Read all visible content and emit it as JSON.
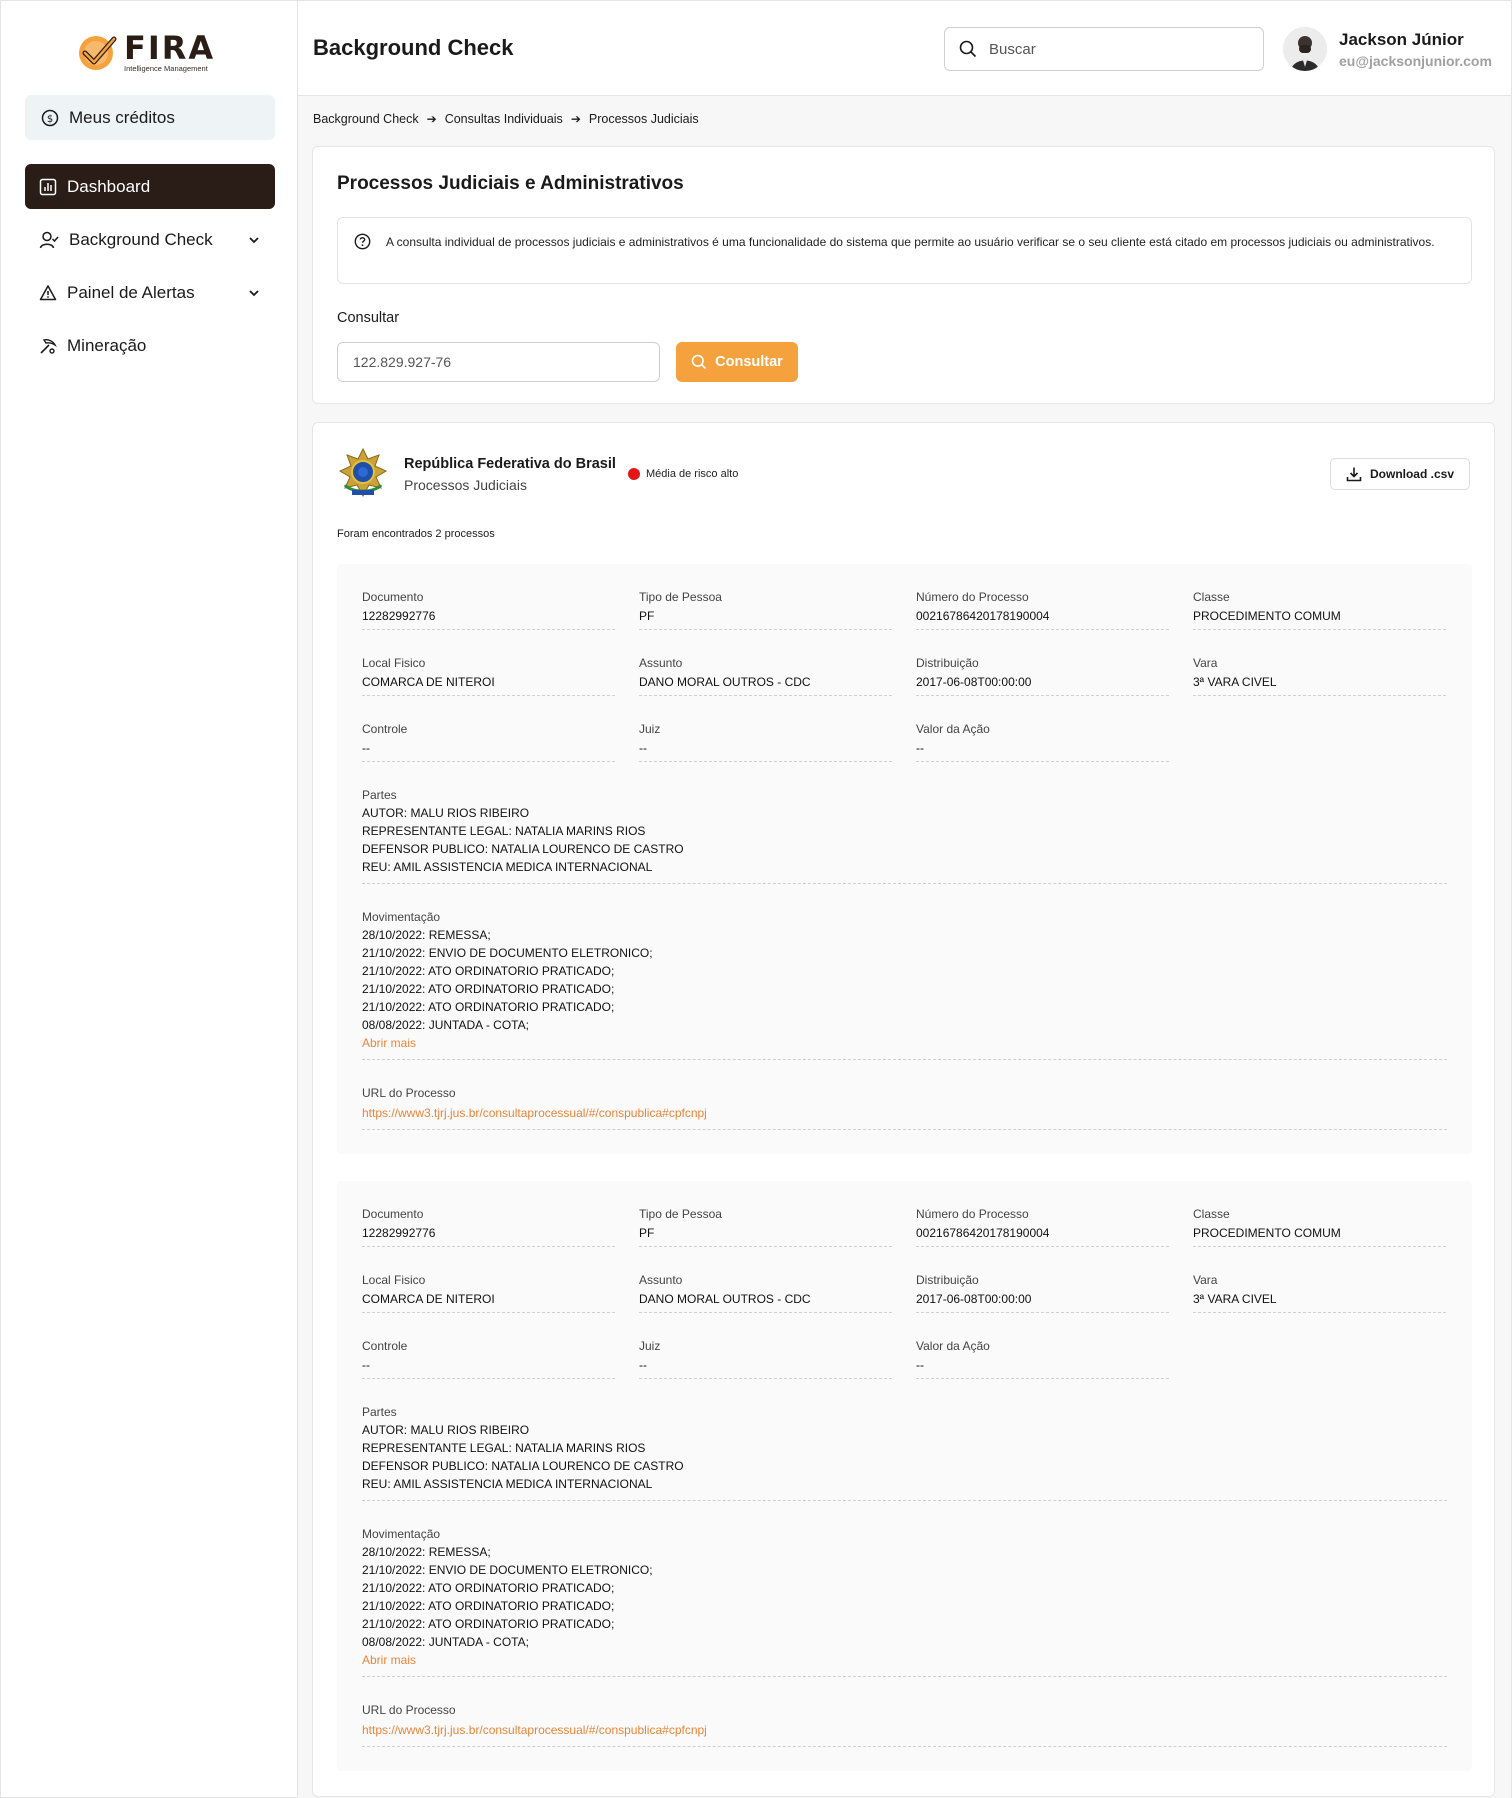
{
  "app": {
    "logo_word": "FIRA",
    "logo_sub": "Intelligence Management",
    "brand_color": "#f5a23e",
    "dark_color": "#2a1c17"
  },
  "sidebar": {
    "credits_label": "Meus créditos",
    "items": [
      {
        "label": "Dashboard",
        "icon": "chart-icon",
        "active": true
      },
      {
        "label": "Background Check",
        "icon": "user-check-icon",
        "chevron": true
      },
      {
        "label": "Painel de Alertas",
        "icon": "warning-icon",
        "chevron": true
      },
      {
        "label": "Mineração",
        "icon": "mining-icon"
      }
    ]
  },
  "header": {
    "title": "Background Check",
    "search_placeholder": "Buscar",
    "user_name": "Jackson Júnior",
    "user_email": "eu@jacksonjunior.com"
  },
  "breadcrumb": [
    "Background Check",
    "Consultas Individuais",
    "Processos Judiciais"
  ],
  "query_card": {
    "title": "Processos Judiciais e Administrativos",
    "info": "A consulta individual de processos judiciais e administrativos é uma funcionalidade do sistema que permite ao usuário verificar se o seu cliente está citado em processos judiciais ou administrativos.",
    "consult_label": "Consultar",
    "input_value": "122.829.927-76",
    "button_label": "Consultar"
  },
  "result_card": {
    "source_name": "República Federativa do Brasil",
    "source_sub": "Processos Judiciais",
    "risk_label": "Média de risco alto",
    "risk_color": "#e21616",
    "download_label": "Download .csv",
    "found_text": "Foram encontrados 2 processos",
    "processes": [
      {
        "documento_label": "Documento",
        "documento": "12282992776",
        "tipo_label": "Tipo de Pessoa",
        "tipo": "PF",
        "numero_label": "Número do Processo",
        "numero": "00216786420178190004",
        "classe_label": "Classe",
        "classe": "PROCEDIMENTO COMUM",
        "local_label": "Local Fisico",
        "local": "COMARCA DE NITEROI",
        "assunto_label": "Assunto",
        "assunto": "DANO MORAL OUTROS - CDC",
        "distribuicao_label": "Distribuição",
        "distribuicao": "2017-06-08T00:00:00",
        "vara_label": "Vara",
        "vara": "3ª VARA CIVEL",
        "controle_label": "Controle",
        "controle": "--",
        "juiz_label": "Juiz",
        "juiz": "--",
        "valor_label": "Valor da Ação",
        "valor": "--",
        "partes_label": "Partes",
        "partes": [
          "AUTOR: MALU RIOS RIBEIRO",
          "REPRESENTANTE LEGAL: NATALIA MARINS RIOS",
          "DEFENSOR PUBLICO: NATALIA LOURENCO DE CASTRO",
          "REU: AMIL ASSISTENCIA MEDICA INTERNACIONAL"
        ],
        "mov_label": "Movimentação",
        "movimentacao": [
          "28/10/2022: REMESSA;",
          "21/10/2022: ENVIO DE DOCUMENTO ELETRONICO;",
          "21/10/2022: ATO ORDINATORIO PRATICADO;",
          "21/10/2022: ATO ORDINATORIO PRATICADO;",
          "21/10/2022: ATO ORDINATORIO PRATICADO;",
          "08/08/2022: JUNTADA - COTA;"
        ],
        "abrir_mais": "Abrir mais",
        "url_label": "URL do Processo",
        "url": "https://www3.tjrj.jus.br/consultaprocessual/#/conspublica#cpfcnpj"
      },
      {
        "documento_label": "Documento",
        "documento": "12282992776",
        "tipo_label": "Tipo de Pessoa",
        "tipo": "PF",
        "numero_label": "Número do Processo",
        "numero": "00216786420178190004",
        "classe_label": "Classe",
        "classe": "PROCEDIMENTO COMUM",
        "local_label": "Local Fisico",
        "local": "COMARCA DE NITEROI",
        "assunto_label": "Assunto",
        "assunto": "DANO MORAL OUTROS - CDC",
        "distribuicao_label": "Distribuição",
        "distribuicao": "2017-06-08T00:00:00",
        "vara_label": "Vara",
        "vara": "3ª VARA CIVEL",
        "controle_label": "Controle",
        "controle": "--",
        "juiz_label": "Juiz",
        "juiz": "--",
        "valor_label": "Valor da Ação",
        "valor": "--",
        "partes_label": "Partes",
        "partes": [
          "AUTOR: MALU RIOS RIBEIRO",
          "REPRESENTANTE LEGAL: NATALIA MARINS RIOS",
          "DEFENSOR PUBLICO: NATALIA LOURENCO DE CASTRO",
          "REU: AMIL ASSISTENCIA MEDICA INTERNACIONAL"
        ],
        "mov_label": "Movimentação",
        "movimentacao": [
          "28/10/2022: REMESSA;",
          "21/10/2022: ENVIO DE DOCUMENTO ELETRONICO;",
          "21/10/2022: ATO ORDINATORIO PRATICADO;",
          "21/10/2022: ATO ORDINATORIO PRATICADO;",
          "21/10/2022: ATO ORDINATORIO PRATICADO;",
          "08/08/2022: JUNTADA - COTA;"
        ],
        "abrir_mais": "Abrir mais",
        "url_label": "URL do Processo",
        "url": "https://www3.tjrj.jus.br/consultaprocessual/#/conspublica#cpfcnpj"
      }
    ]
  }
}
